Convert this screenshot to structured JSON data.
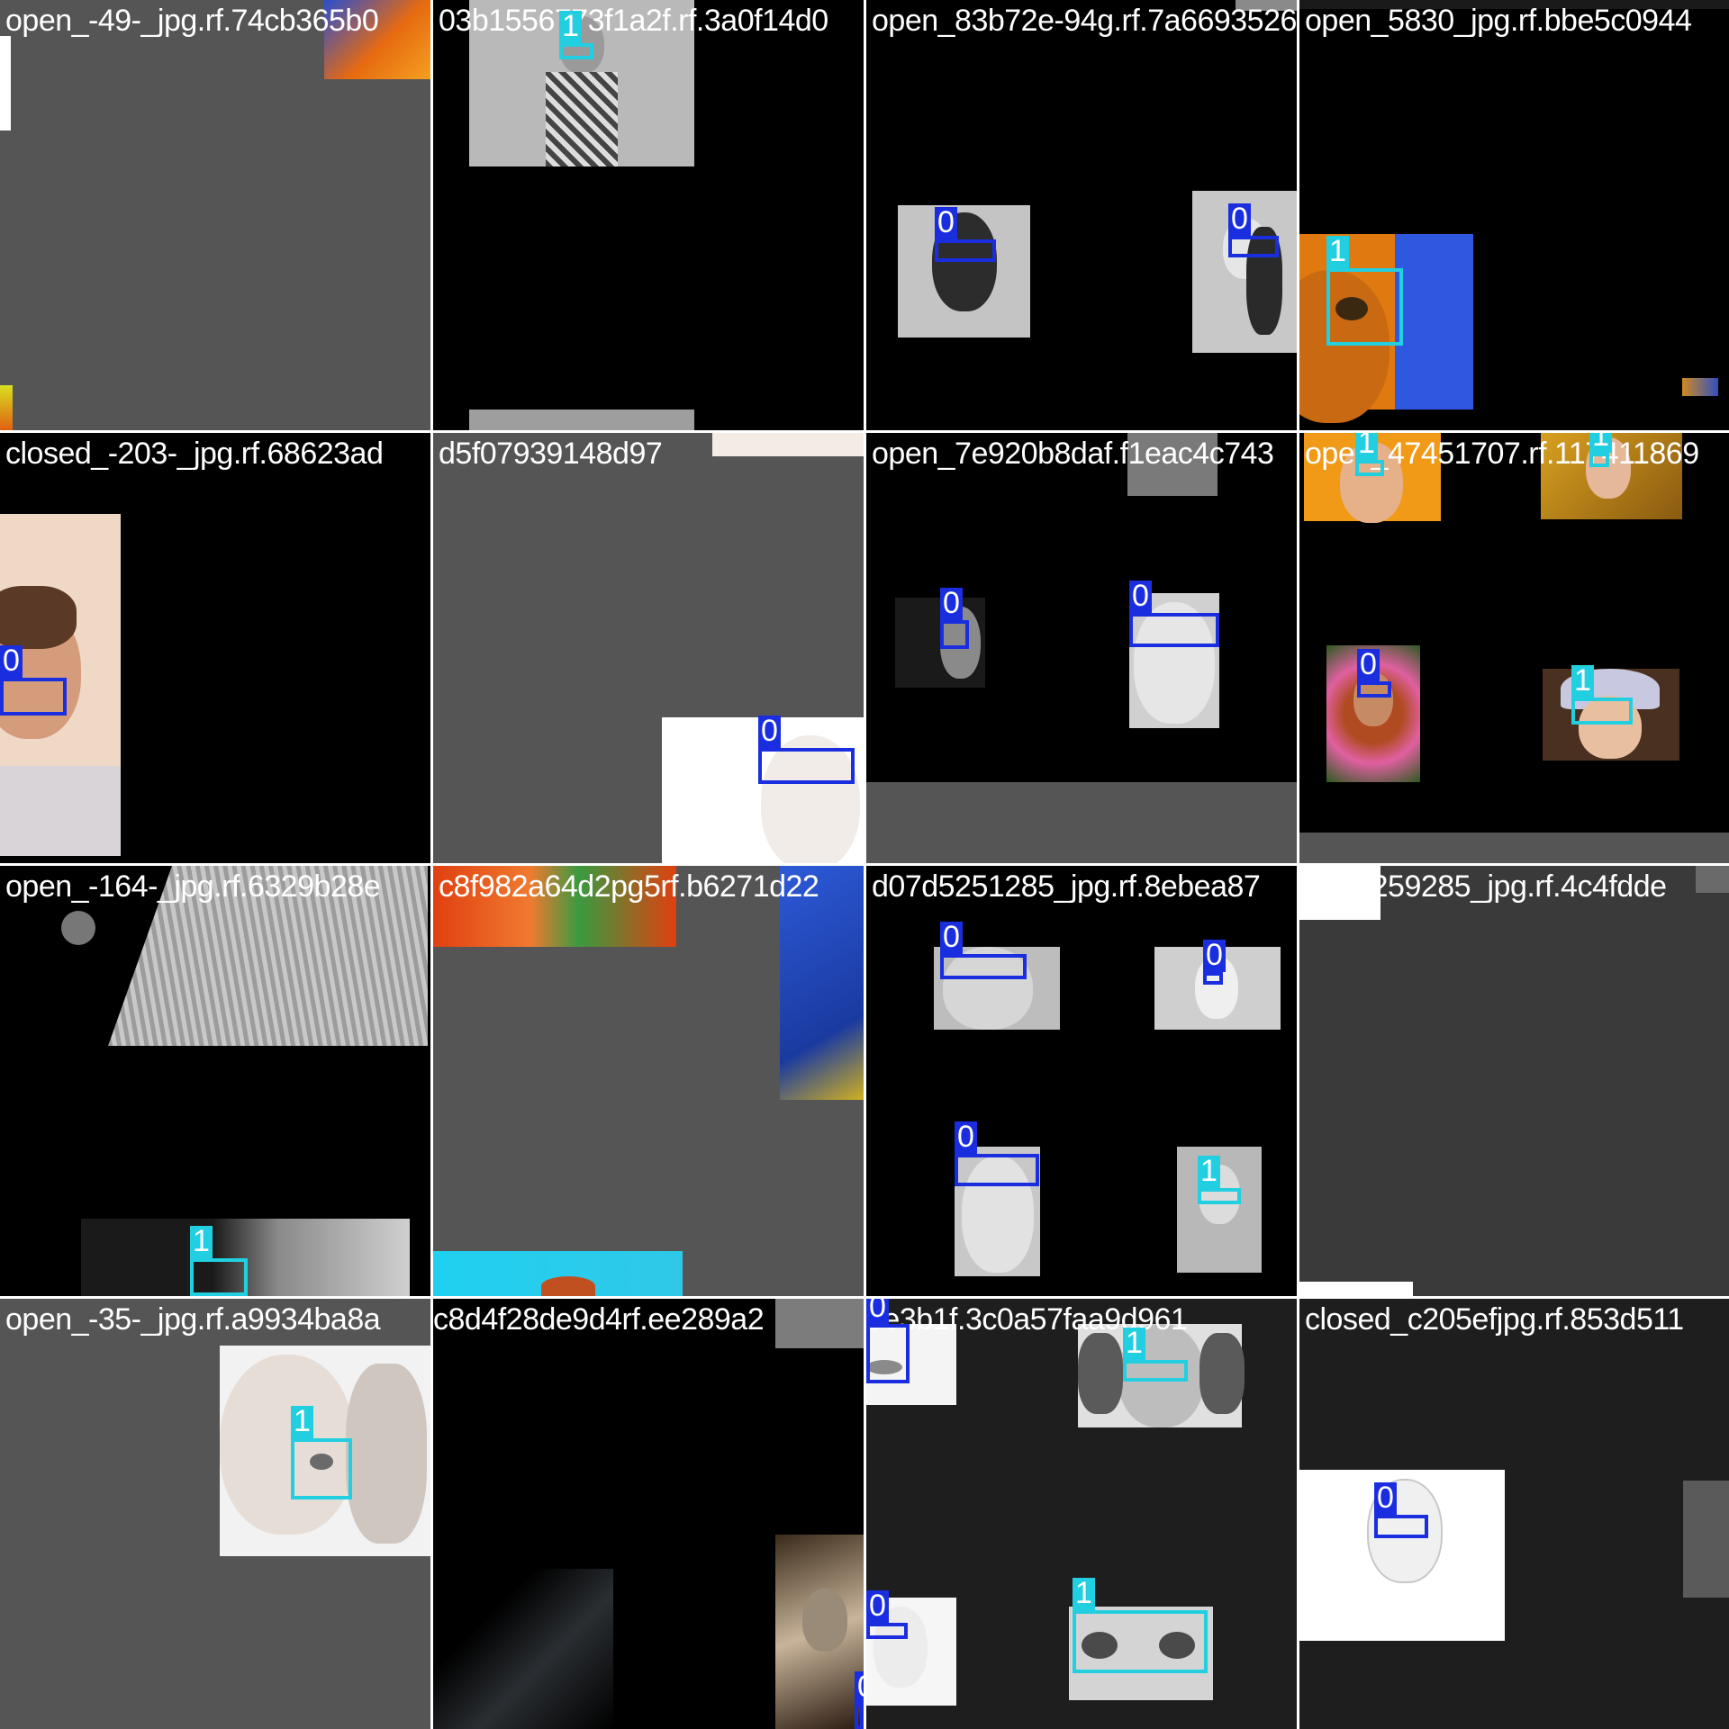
{
  "mosaic": {
    "tiles": [
      {
        "label": "open_-49-_jpg.rf.74cb365b0",
        "boxes": []
      },
      {
        "label": "03b1556773f1a2f.rf.3a0f14d0",
        "boxes": [
          {
            "cls": "1"
          }
        ]
      },
      {
        "label": "open_83b72e-94g.rf.7a6693526",
        "boxes": [
          {
            "cls": "0"
          },
          {
            "cls": "0"
          }
        ]
      },
      {
        "label": "open_5830_jpg.rf.bbe5c0944",
        "boxes": [
          {
            "cls": "1"
          }
        ]
      },
      {
        "label": "closed_-203-_jpg.rf.68623ad",
        "boxes": [
          {
            "cls": "0"
          }
        ]
      },
      {
        "label": "d5f07939148d97",
        "boxes": [
          {
            "cls": "0"
          }
        ]
      },
      {
        "label": "open_7e920b8daf.f1eac4c743",
        "boxes": [
          {
            "cls": "0"
          },
          {
            "cls": "0"
          }
        ]
      },
      {
        "label": "open_47451707.rf.117411869",
        "boxes": [
          {
            "cls": "1"
          },
          {
            "cls": "1"
          },
          {
            "cls": "0"
          },
          {
            "cls": "1"
          }
        ]
      },
      {
        "label": "open_-164-_jpg.rf.6329b28e",
        "boxes": [
          {
            "cls": "1"
          }
        ]
      },
      {
        "label": "c8f982a64d2pg5rf.b6271d22",
        "boxes": []
      },
      {
        "label": "d07d5251285_jpg.rf.8ebea87",
        "boxes": [
          {
            "cls": "0"
          },
          {
            "cls": "0"
          },
          {
            "cls": "0"
          },
          {
            "cls": "1"
          }
        ]
      },
      {
        "label": "d0ab259285_jpg.rf.4c4fdde",
        "boxes": []
      },
      {
        "label": "open_-35-_jpg.rf.a9934ba8a",
        "boxes": [
          {
            "cls": "1"
          }
        ]
      },
      {
        "label": "c8d4f28de9d4rf.ee289a2",
        "boxes": [
          {
            "cls": "0"
          }
        ]
      },
      {
        "label": "8e3b1f.3c0a57faa9d961",
        "boxes": [
          {
            "cls": "0"
          },
          {
            "cls": "1"
          },
          {
            "cls": "0"
          },
          {
            "cls": "1"
          }
        ]
      },
      {
        "label": "closed_c205efjpg.rf.853d511",
        "boxes": [
          {
            "cls": "0"
          }
        ]
      }
    ]
  },
  "class_colors": {
    "0": "#1a2ee0",
    "1": "#22cfe0"
  }
}
